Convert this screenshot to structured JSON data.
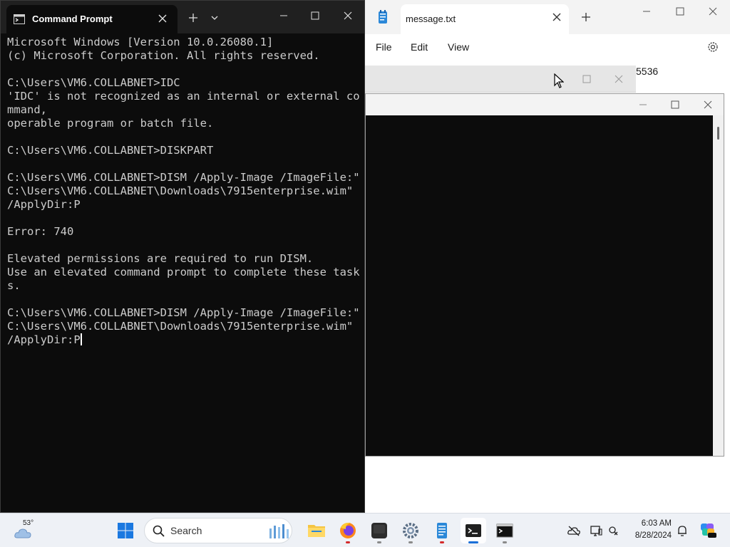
{
  "notepad": {
    "tab_title": "message.txt",
    "menu": [
      "File",
      "Edit",
      "View"
    ],
    "text_fragment": "5536"
  },
  "cmd": {
    "tab_title": "Command Prompt",
    "lines": [
      "Microsoft Windows [Version 10.0.26080.1]",
      "(c) Microsoft Corporation. All rights reserved.",
      "",
      "C:\\Users\\VM6.COLLABNET>IDC",
      "'IDC' is not recognized as an internal or external co",
      "mmand,",
      "operable program or batch file.",
      "",
      "C:\\Users\\VM6.COLLABNET>DISKPART",
      "",
      "C:\\Users\\VM6.COLLABNET>DISM /Apply-Image /ImageFile:\"",
      "C:\\Users\\VM6.COLLABNET\\Downloads\\7915enterprise.wim\"",
      "/ApplyDir:P",
      "",
      "Error: 740",
      "",
      "Elevated permissions are required to run DISM.",
      "Use an elevated command prompt to complete these task",
      "s.",
      "",
      "C:\\Users\\VM6.COLLABNET>DISM /Apply-Image /ImageFile:\"",
      "C:\\Users\\VM6.COLLABNET\\Downloads\\7915enterprise.wim\"",
      "/ApplyDir:P"
    ]
  },
  "taskbar": {
    "temperature": "53°",
    "search_label": "Search",
    "time": "6:03 AM",
    "date": "8/28/2024"
  },
  "colors": {
    "console_bg": "#0c0c0c",
    "console_text": "#cccccc",
    "taskbar_bg": "#eef1f6",
    "accent_blue": "#1a6fd8"
  }
}
